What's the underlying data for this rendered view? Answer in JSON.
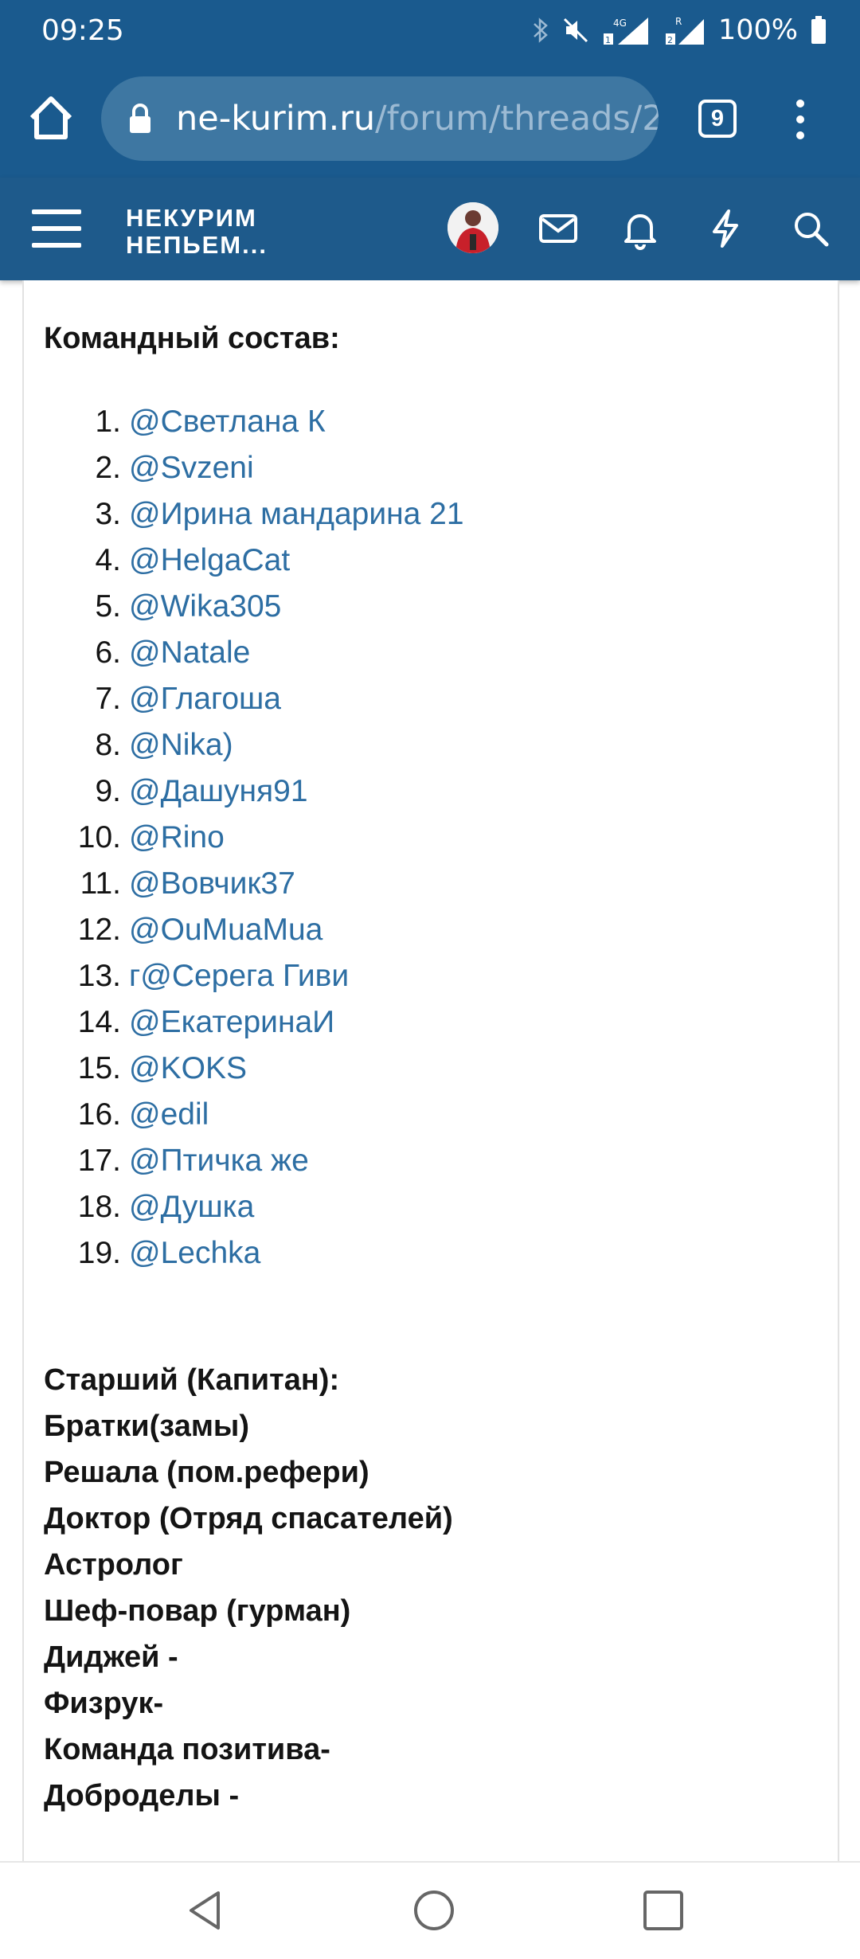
{
  "status_bar": {
    "time": "09:25",
    "battery": "100%",
    "icons": [
      "bluetooth-icon",
      "mute-icon",
      "signal-4g-sim1-icon",
      "signal-sim2-icon",
      "battery-icon"
    ],
    "network_label_1": "4G",
    "network_label_2": "R"
  },
  "browser": {
    "url_domain": "ne-kurim.ru",
    "url_path": "/forum/threads/2",
    "tab_count": "9"
  },
  "site_header": {
    "logo_line1": "НЕКУРИМ",
    "logo_line2": "НЕПЬЕМ..."
  },
  "content": {
    "heading": "Командный состав:",
    "members": [
      {
        "num": "1.",
        "name": "@Светлана К"
      },
      {
        "num": "2.",
        "name": "@Svzeni"
      },
      {
        "num": "3.",
        "name": "@Ирина мандарина 21"
      },
      {
        "num": "4.",
        "name": "@HelgaCat"
      },
      {
        "num": "5.",
        "name": "@Wika305"
      },
      {
        "num": "6.",
        "name": "@Natale"
      },
      {
        "num": "7.",
        "name": "@Глагоша"
      },
      {
        "num": "8.",
        "name": "@Nika)"
      },
      {
        "num": "9.",
        "name": "@Дашуня91"
      },
      {
        "num": "10.",
        "name": "@Rino"
      },
      {
        "num": "11.",
        "name": "@Вовчик37"
      },
      {
        "num": "12.",
        "name": "@OuMuaMua"
      },
      {
        "num": "13.",
        "name": "г@Серега Гиви"
      },
      {
        "num": "14.",
        "name": "@ЕкатеринаИ"
      },
      {
        "num": "15.",
        "name": "@KOKS"
      },
      {
        "num": "16.",
        "name": "@edil"
      },
      {
        "num": "17.",
        "name": "@Птичка же"
      },
      {
        "num": "18.",
        "name": "@Душка"
      },
      {
        "num": "19.",
        "name": "@Lechka"
      }
    ],
    "roles": [
      "Старший (Капитан):",
      "Братки(замы)",
      "Решала (пом.рефери)",
      "Доктор (Отряд спасателей)",
      "Астролог",
      "Шеф-повар (гурман)",
      "Диджей -",
      "Физрук-",
      "Команда позитива-",
      "Доброделы -"
    ]
  },
  "colors": {
    "header_blue": "#1e5a8b",
    "link_blue": "#2d6ea3",
    "url_pill": "#3e77a2"
  }
}
